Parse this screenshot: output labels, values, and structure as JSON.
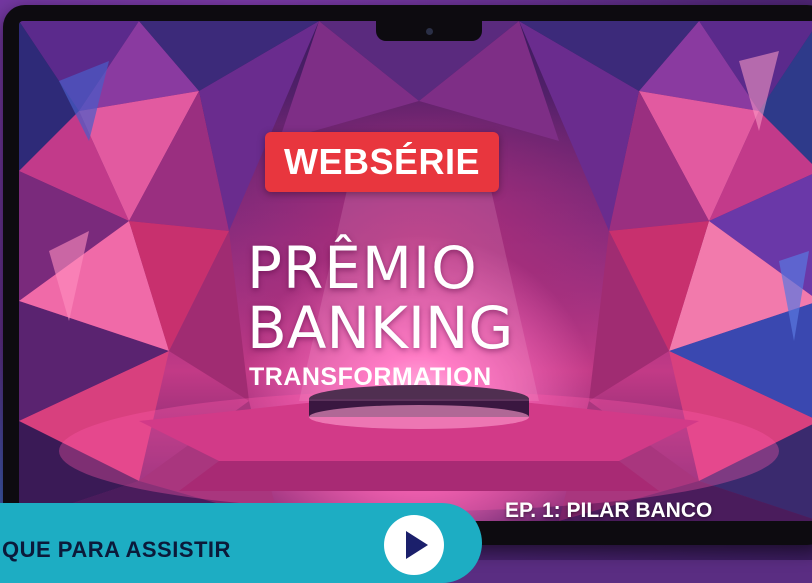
{
  "badge": {
    "label": "WEBSÉRIE"
  },
  "title": {
    "line1": "PRÊMIO",
    "line2": "BANKING",
    "subtitle": "TRANSFORMATION"
  },
  "episode": {
    "label": "EP. 1: PILAR BANCO"
  },
  "cta": {
    "label": "QUE PARA ASSISTIR",
    "icon": "play-icon"
  },
  "colors": {
    "badge": "#e8363e",
    "cta": "#1dadc3",
    "background": "#5a2d82",
    "frame": "#0d0b10"
  }
}
